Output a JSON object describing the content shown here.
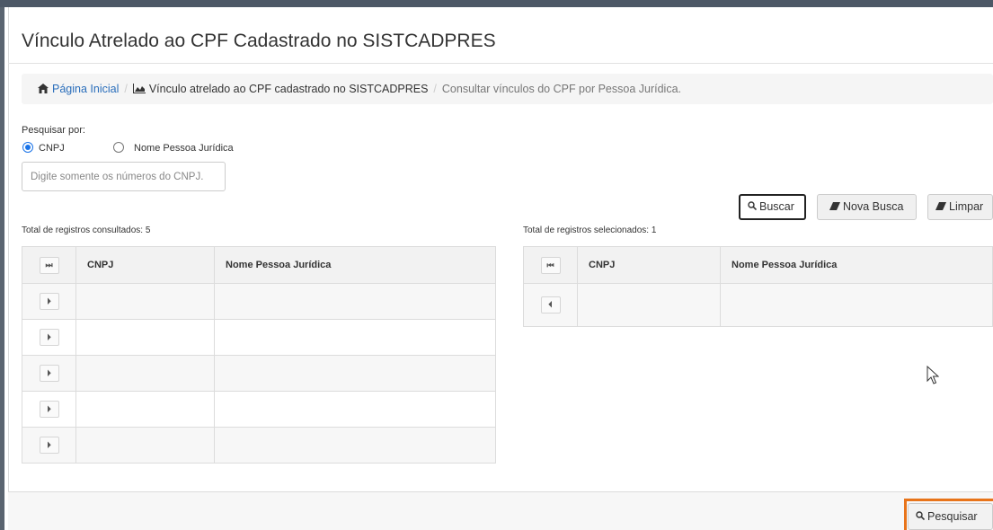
{
  "page": {
    "title": "Vínculo Atrelado ao CPF Cadastrado no SISTCADPRES"
  },
  "breadcrumb": {
    "home": "Página Inicial",
    "middle": "Vínculo atrelado ao CPF cadastrado no SISTCADPRES",
    "current": "Consultar vínculos do CPF por Pessoa Jurídica.",
    "separator": "/"
  },
  "search": {
    "label": "Pesquisar por:",
    "options": [
      {
        "label": "CNPJ",
        "selected": true
      },
      {
        "label": "Nome Pessoa Jurídica",
        "selected": false
      }
    ],
    "placeholder": "Digite somente os números do CNPJ."
  },
  "buttons": {
    "buscar": "Buscar",
    "nova_busca": "Nova Busca",
    "limpar": "Limpar",
    "pesquisar": "Pesquisar"
  },
  "left_table": {
    "total_label": "Total de registros consultados: 5",
    "header_icon": "⏭",
    "columns": [
      "CNPJ",
      "Nome Pessoa Jurídica"
    ],
    "row_icon": "⏵",
    "rows": [
      {
        "cnpj": "",
        "nome": ""
      },
      {
        "cnpj": "",
        "nome": ""
      },
      {
        "cnpj": "",
        "nome": ""
      },
      {
        "cnpj": "",
        "nome": ""
      },
      {
        "cnpj": "",
        "nome": ""
      }
    ]
  },
  "right_table": {
    "total_label": "Total de registros selecionados: 1",
    "header_icon": "⏮",
    "columns": [
      "CNPJ",
      "Nome Pessoa Jurídica"
    ],
    "row_icon": "⏴",
    "rows": [
      {
        "cnpj": "",
        "nome": ""
      }
    ]
  },
  "icons": {
    "home": "home-icon",
    "chart": "area-chart-icon",
    "search": "search-icon",
    "eraser": "eraser-icon"
  },
  "colors": {
    "link": "#2a6ebb",
    "radio_accent": "#1a73e8",
    "highlight": "#e8741a"
  }
}
